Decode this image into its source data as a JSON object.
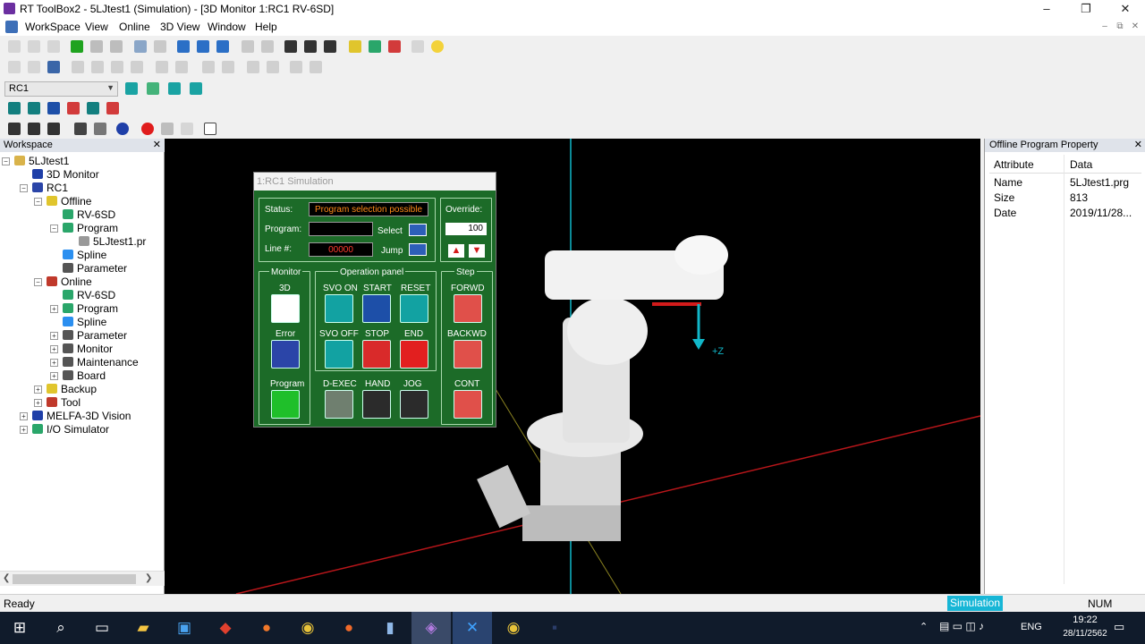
{
  "window": {
    "title": "RT ToolBox2 - 5LJtest1  (Simulation) - [3D Monitor 1:RC1 RV-6SD]",
    "controls": {
      "minimize": "–",
      "restore": "❐",
      "close": "✕"
    },
    "mdi_controls": {
      "minimize": "–",
      "restore": "⧉",
      "close": "✕"
    }
  },
  "menu": [
    "WorkSpace",
    "View",
    "Online",
    "3D View",
    "Window",
    "Help"
  ],
  "controller_combo": {
    "value": "RC1"
  },
  "workspace": {
    "title": "Workspace",
    "close": "✕",
    "tree": [
      {
        "label": "5LJtest1",
        "expander": "−"
      },
      {
        "label": "3D Monitor"
      },
      {
        "label": "RC1",
        "expander": "−"
      },
      {
        "label": "Offline",
        "expander": "−"
      },
      {
        "label": "RV-6SD"
      },
      {
        "label": "Program",
        "expander": "−"
      },
      {
        "label": "5LJtest1.pr"
      },
      {
        "label": "Spline"
      },
      {
        "label": "Parameter"
      },
      {
        "label": "Online",
        "expander": "−"
      },
      {
        "label": "RV-6SD"
      },
      {
        "label": "Program",
        "expander": "+"
      },
      {
        "label": "Spline"
      },
      {
        "label": "Parameter",
        "expander": "+"
      },
      {
        "label": "Monitor",
        "expander": "+"
      },
      {
        "label": "Maintenance",
        "expander": "+"
      },
      {
        "label": "Board",
        "expander": "+"
      },
      {
        "label": "Backup",
        "expander": "+"
      },
      {
        "label": "Tool",
        "expander": "+"
      },
      {
        "label": "MELFA-3D Vision",
        "expander": "+"
      },
      {
        "label": "I/O Simulator",
        "expander": "+"
      }
    ],
    "scroll_left": "❮",
    "scroll_right": "❯"
  },
  "simulation_panel": {
    "title": "1:RC1 Simulation",
    "status_label": "Status:",
    "status_value": "Program selection possible",
    "program_label": "Program:",
    "program_value": "",
    "select_label": "Select",
    "line_label": "Line #:",
    "line_value": "00000",
    "jump_label": "Jump",
    "override_label": "Override:",
    "override_value": "100",
    "monitor_title": "Monitor",
    "opanel_title": "Operation panel",
    "step_title": "Step",
    "labels": {
      "m3d": "3D",
      "error": "Error",
      "program": "Program",
      "svo_on": "SVO ON",
      "start": "START",
      "reset": "RESET",
      "svo_off": "SVO OFF",
      "stop": "STOP",
      "end": "END",
      "dexec": "D-EXEC",
      "hand": "HAND",
      "jog": "JOG",
      "forwd": "FORWD",
      "backwd": "BACKWD",
      "cont": "CONT"
    }
  },
  "viewport": {
    "axis_label": "+Z"
  },
  "property": {
    "title": "Offline Program Property",
    "close": "✕",
    "col_attr": "Attribute",
    "col_data": "Data",
    "rows": [
      {
        "attr": "Name",
        "data": "5LJtest1.prg"
      },
      {
        "attr": "Size",
        "data": "813"
      },
      {
        "attr": "Date",
        "data": "2019/11/28..."
      }
    ]
  },
  "statusbar": {
    "left": "Ready",
    "mode": "Simulation",
    "num": "NUM"
  },
  "taskbar": {
    "lang": "ENG",
    "time": "19:22",
    "date": "28/11/2562"
  },
  "colors": {
    "viewport_bg": "#000000",
    "sim_panel": "#1c6b28",
    "status_orange": "#ff8c1a",
    "simulation_badge": "#17b6d6"
  }
}
